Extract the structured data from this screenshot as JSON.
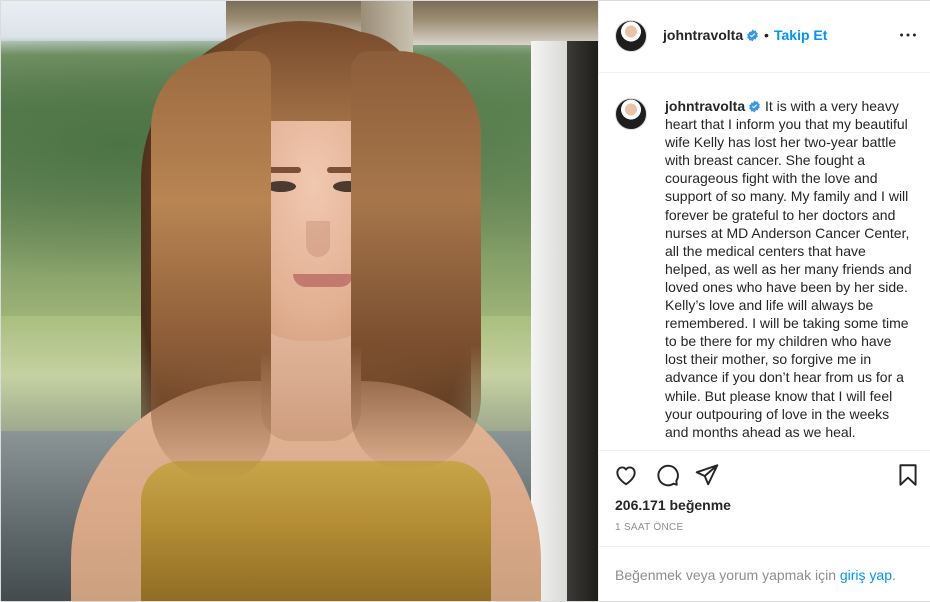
{
  "photo": {
    "icon": "photo-of-woman"
  },
  "header": {
    "username": "johntravolta",
    "separator": "•",
    "follow_label": "Takip Et",
    "more_icon": "more-horizontal-icon"
  },
  "caption": {
    "username": "johntravolta",
    "text": "It is with a very heavy heart that I inform you that my beautiful wife Kelly has lost her two-year battle with breast cancer. She fought a courageous fight with the love and support of so many.  My family and I will forever be grateful to her doctors and nurses at MD Anderson Cancer Center, all the medical centers that have helped, as well as her many friends and loved ones who have been by her side. Kelly’s love and life will always be remembered. I will be taking some time to be there for my children who have lost their mother, so forgive me in advance if you don’t hear from us for a while.  But please know that I will feel your outpouring of love in the weeks and months ahead as we heal."
  },
  "actions": {
    "like_icon": "heart-icon",
    "comment_icon": "comment-icon",
    "share_icon": "send-icon",
    "save_icon": "bookmark-icon"
  },
  "stats": {
    "likes": "206.171 beğenme",
    "time_ago": "1 SAAT ÖNCE"
  },
  "login": {
    "prefix": "Beğenmek veya yorum yapmak için ",
    "link": "giriş yap",
    "suffix": "."
  },
  "colors": {
    "accent": "#0095f6",
    "text": "#262626",
    "muted": "#8e8e8e",
    "border": "#efefef"
  }
}
